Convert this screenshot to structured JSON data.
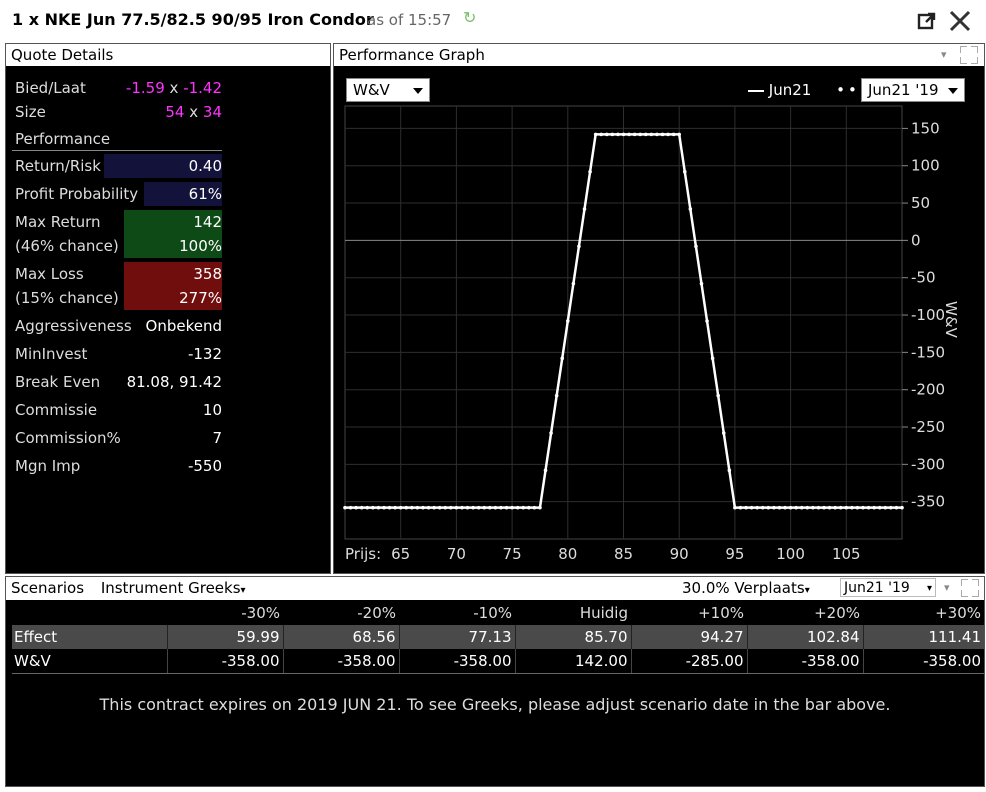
{
  "window": {
    "title": "1 x NKE Jun 77.5/82.5 90/95 Iron Condor",
    "as_of": "as of 15:57"
  },
  "quote": {
    "header": "Quote Details",
    "bid_ask": {
      "label": "Bied/Laat",
      "bid": "-1.59",
      "sep": "x",
      "ask": "-1.42"
    },
    "size": {
      "label": "Size",
      "bid": "54",
      "sep": "x",
      "ask": "34"
    },
    "performance_label": "Performance",
    "return_risk": {
      "label": "Return/Risk",
      "value": "0.40"
    },
    "profit_probability": {
      "label": "Profit Probability",
      "value": "61%"
    },
    "max_return": {
      "label": "Max Return",
      "value": "142",
      "sub_label": "(46% chance)",
      "sub_value": "100%"
    },
    "max_loss": {
      "label": "Max Loss",
      "value": "358",
      "sub_label": "(15% chance)",
      "sub_value": "277%"
    },
    "aggressiveness": {
      "label": "Aggressiveness",
      "value": "Onbekend"
    },
    "min_invest": {
      "label": "MinInvest",
      "value": "-132"
    },
    "break_even": {
      "label": "Break Even",
      "value": "81.08, 91.42"
    },
    "commissie": {
      "label": "Commissie",
      "value": "10"
    },
    "commission_pct": {
      "label": "Commission%",
      "value": "7"
    },
    "mgn_imp": {
      "label": "Mgn Imp",
      "value": "-550"
    }
  },
  "graph": {
    "header": "Performance Graph",
    "metric_select": "W&V",
    "legend_series": "Jun21",
    "date_select": "Jun21 '19",
    "colors": {
      "line": "#ffffff",
      "grid": "#2e2e2e",
      "zero": "#888888"
    }
  },
  "chart_data": {
    "type": "line",
    "x_label_prefix": "Prijs:",
    "y_label": "W&V",
    "xlim": [
      60,
      110
    ],
    "ylim": [
      -400,
      180
    ],
    "x_ticks": [
      65,
      70,
      75,
      80,
      85,
      90,
      95,
      100,
      105
    ],
    "y_ticks": [
      150,
      100,
      50,
      0,
      -50,
      -100,
      -150,
      -200,
      -250,
      -300,
      -350
    ],
    "series": [
      {
        "name": "Jun21",
        "x": [
          60,
          77.5,
          82.5,
          90,
          95,
          110
        ],
        "y": [
          -358,
          -358,
          142,
          142,
          -358,
          -358
        ]
      }
    ]
  },
  "scenarios": {
    "header": "Scenarios",
    "mode_select": "Instrument Greeks",
    "move_select": "30.0% Verplaats",
    "date_select": "Jun21 '19",
    "columns": [
      "-30%",
      "-20%",
      "-10%",
      "Huidig",
      "+10%",
      "+20%",
      "+30%"
    ],
    "rows": [
      {
        "label": "Effect",
        "values": [
          "59.99",
          "68.56",
          "77.13",
          "85.70",
          "94.27",
          "102.84",
          "111.41"
        ]
      },
      {
        "label": "W&V",
        "values": [
          "-358.00",
          "-358.00",
          "-358.00",
          "142.00",
          "-285.00",
          "-358.00",
          "-358.00"
        ]
      }
    ],
    "note": "This contract expires on 2019 JUN 21. To see Greeks, please adjust scenario date in the bar above."
  }
}
